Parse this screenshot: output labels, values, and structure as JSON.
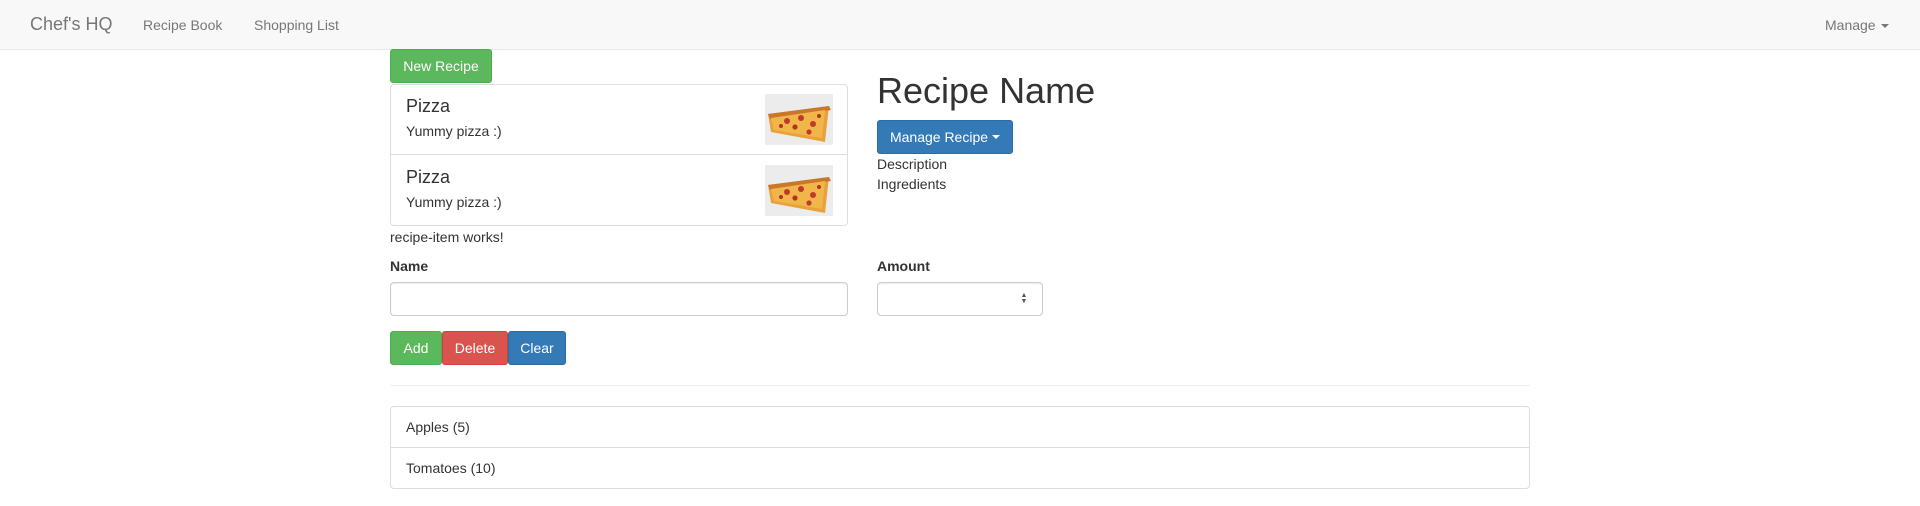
{
  "navbar": {
    "brand": "Chef's HQ",
    "links": [
      "Recipe Book",
      "Shopping List"
    ],
    "manage_label": "Manage"
  },
  "recipe_list": {
    "new_button": "New Recipe",
    "items": [
      {
        "title": "Pizza",
        "description": "Yummy pizza :)"
      },
      {
        "title": "Pizza",
        "description": "Yummy pizza :)"
      }
    ],
    "status_text": "recipe-item works!"
  },
  "recipe_detail": {
    "title": "Recipe Name",
    "manage_button": "Manage Recipe",
    "description_label": "Description",
    "ingredients_label": "Ingredients"
  },
  "shopping_form": {
    "name_label": "Name",
    "name_value": "",
    "amount_label": "Amount",
    "amount_value": "",
    "buttons": {
      "add": "Add",
      "delete": "Delete",
      "clear": "Clear"
    }
  },
  "shopping_list": {
    "items": [
      "Apples (5)",
      "Tomatoes (10)"
    ]
  },
  "colors": {
    "success": "#5cb85c",
    "danger": "#d9534f",
    "primary": "#337ab7",
    "navbar_bg": "#f8f8f8"
  }
}
